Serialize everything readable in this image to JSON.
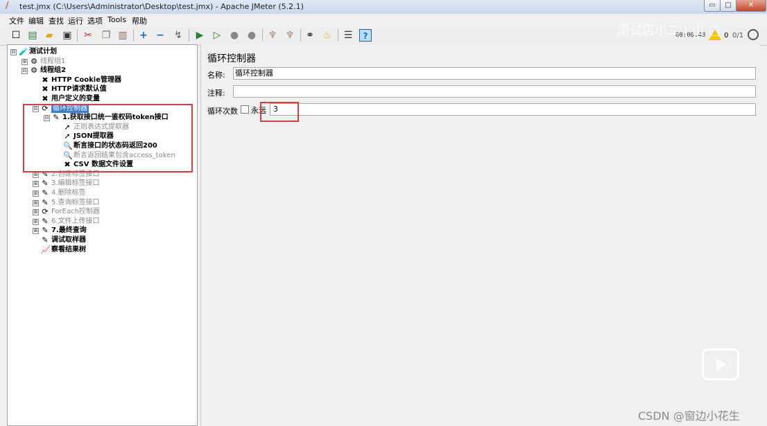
{
  "window": {
    "title": "test.jmx (C:\\Users\\Administrator\\Desktop\\test.jmx) - Apache JMeter (5.2.1)",
    "min_label": "▭",
    "max_label": "□",
    "close_label": "✕"
  },
  "menu": [
    "文件",
    "编辑",
    "查找",
    "运行",
    "选项",
    "Tools",
    "帮助"
  ],
  "toolbar": {
    "icons": [
      "new-icon",
      "templates-icon",
      "open-icon",
      "save-icon",
      "cut-icon",
      "copy-icon",
      "paste-icon",
      "expand-icon",
      "collapse-icon",
      "toggle-icon",
      "start-icon",
      "start-no-pause-icon",
      "stop-icon",
      "shutdown-icon",
      "clear-icon",
      "clear-all-icon",
      "search-icon",
      "reset-search-icon",
      "function-helper-icon",
      "help-icon"
    ],
    "timer": "00:00:48",
    "warnings": "0",
    "threads": "0/1"
  },
  "watermark": {
    "top": "测试店小二 | 山 □",
    "bottom": "CSDN @窗边小花生"
  },
  "tree": [
    {
      "label": "测试计划",
      "indent": 0,
      "expander": "⊟",
      "icon": "🧪",
      "bold": true
    },
    {
      "label": "线程组1",
      "indent": 1,
      "expander": "⊞",
      "icon": "⚙",
      "disabled": true
    },
    {
      "label": "线程组2",
      "indent": 1,
      "expander": "⊟",
      "icon": "⚙",
      "bold": true
    },
    {
      "label": "HTTP Cookie管理器",
      "indent": 2,
      "icon": "✖",
      "bold": true
    },
    {
      "label": "HTTP请求默认值",
      "indent": 2,
      "icon": "✖",
      "bold": true
    },
    {
      "label": "用户定义的变量",
      "indent": 2,
      "icon": "✖",
      "bold": true
    },
    {
      "label": "循环控制器",
      "indent": 2,
      "expander": "⊟",
      "icon": "⟳",
      "selected": true
    },
    {
      "label": "1.获取接口统一鉴权码token接口",
      "indent": 3,
      "expander": "⊟",
      "icon": "✎",
      "bold": true
    },
    {
      "label": "正则表达式提取器",
      "indent": 4,
      "icon": "➚",
      "disabled": true
    },
    {
      "label": "JSON提取器",
      "indent": 4,
      "icon": "➚",
      "bold": true
    },
    {
      "label": "断言接口的状态码返回200",
      "indent": 4,
      "icon": "🔍",
      "bold": true
    },
    {
      "label": "断言返回结果包含access_token",
      "indent": 4,
      "icon": "🔍",
      "disabled": true
    },
    {
      "label": "CSV 数据文件设置",
      "indent": 4,
      "icon": "✖",
      "bold": true
    },
    {
      "label": "2.创建标签接口",
      "indent": 2,
      "expander": "⊞",
      "icon": "✎",
      "disabled": true
    },
    {
      "label": "3.编辑标签接口",
      "indent": 2,
      "expander": "⊞",
      "icon": "✎",
      "disabled": true
    },
    {
      "label": "4.删除标签",
      "indent": 2,
      "expander": "⊞",
      "icon": "✎",
      "disabled": true
    },
    {
      "label": "5.查询标签接口",
      "indent": 2,
      "expander": "⊞",
      "icon": "✎",
      "disabled": true
    },
    {
      "label": "ForEach控制器",
      "indent": 2,
      "expander": "⊞",
      "icon": "⟳",
      "disabled": true
    },
    {
      "label": "6.文件上传接口",
      "indent": 2,
      "expander": "⊞",
      "icon": "✎",
      "disabled": true
    },
    {
      "label": "7.最终查询",
      "indent": 2,
      "expander": "⊞",
      "icon": "✎",
      "bold": true
    },
    {
      "label": "调试取样器",
      "indent": 2,
      "icon": "✎",
      "bold": true
    },
    {
      "label": "察看结果树",
      "indent": 2,
      "icon": "📈",
      "bold": true
    }
  ],
  "panel": {
    "title": "循环控制器",
    "name_label": "名称:",
    "name_value": "循环控制器",
    "comment_label": "注释:",
    "comment_value": "",
    "loops_label": "循环次数",
    "forever_label": "永远",
    "loops_value": "3"
  }
}
